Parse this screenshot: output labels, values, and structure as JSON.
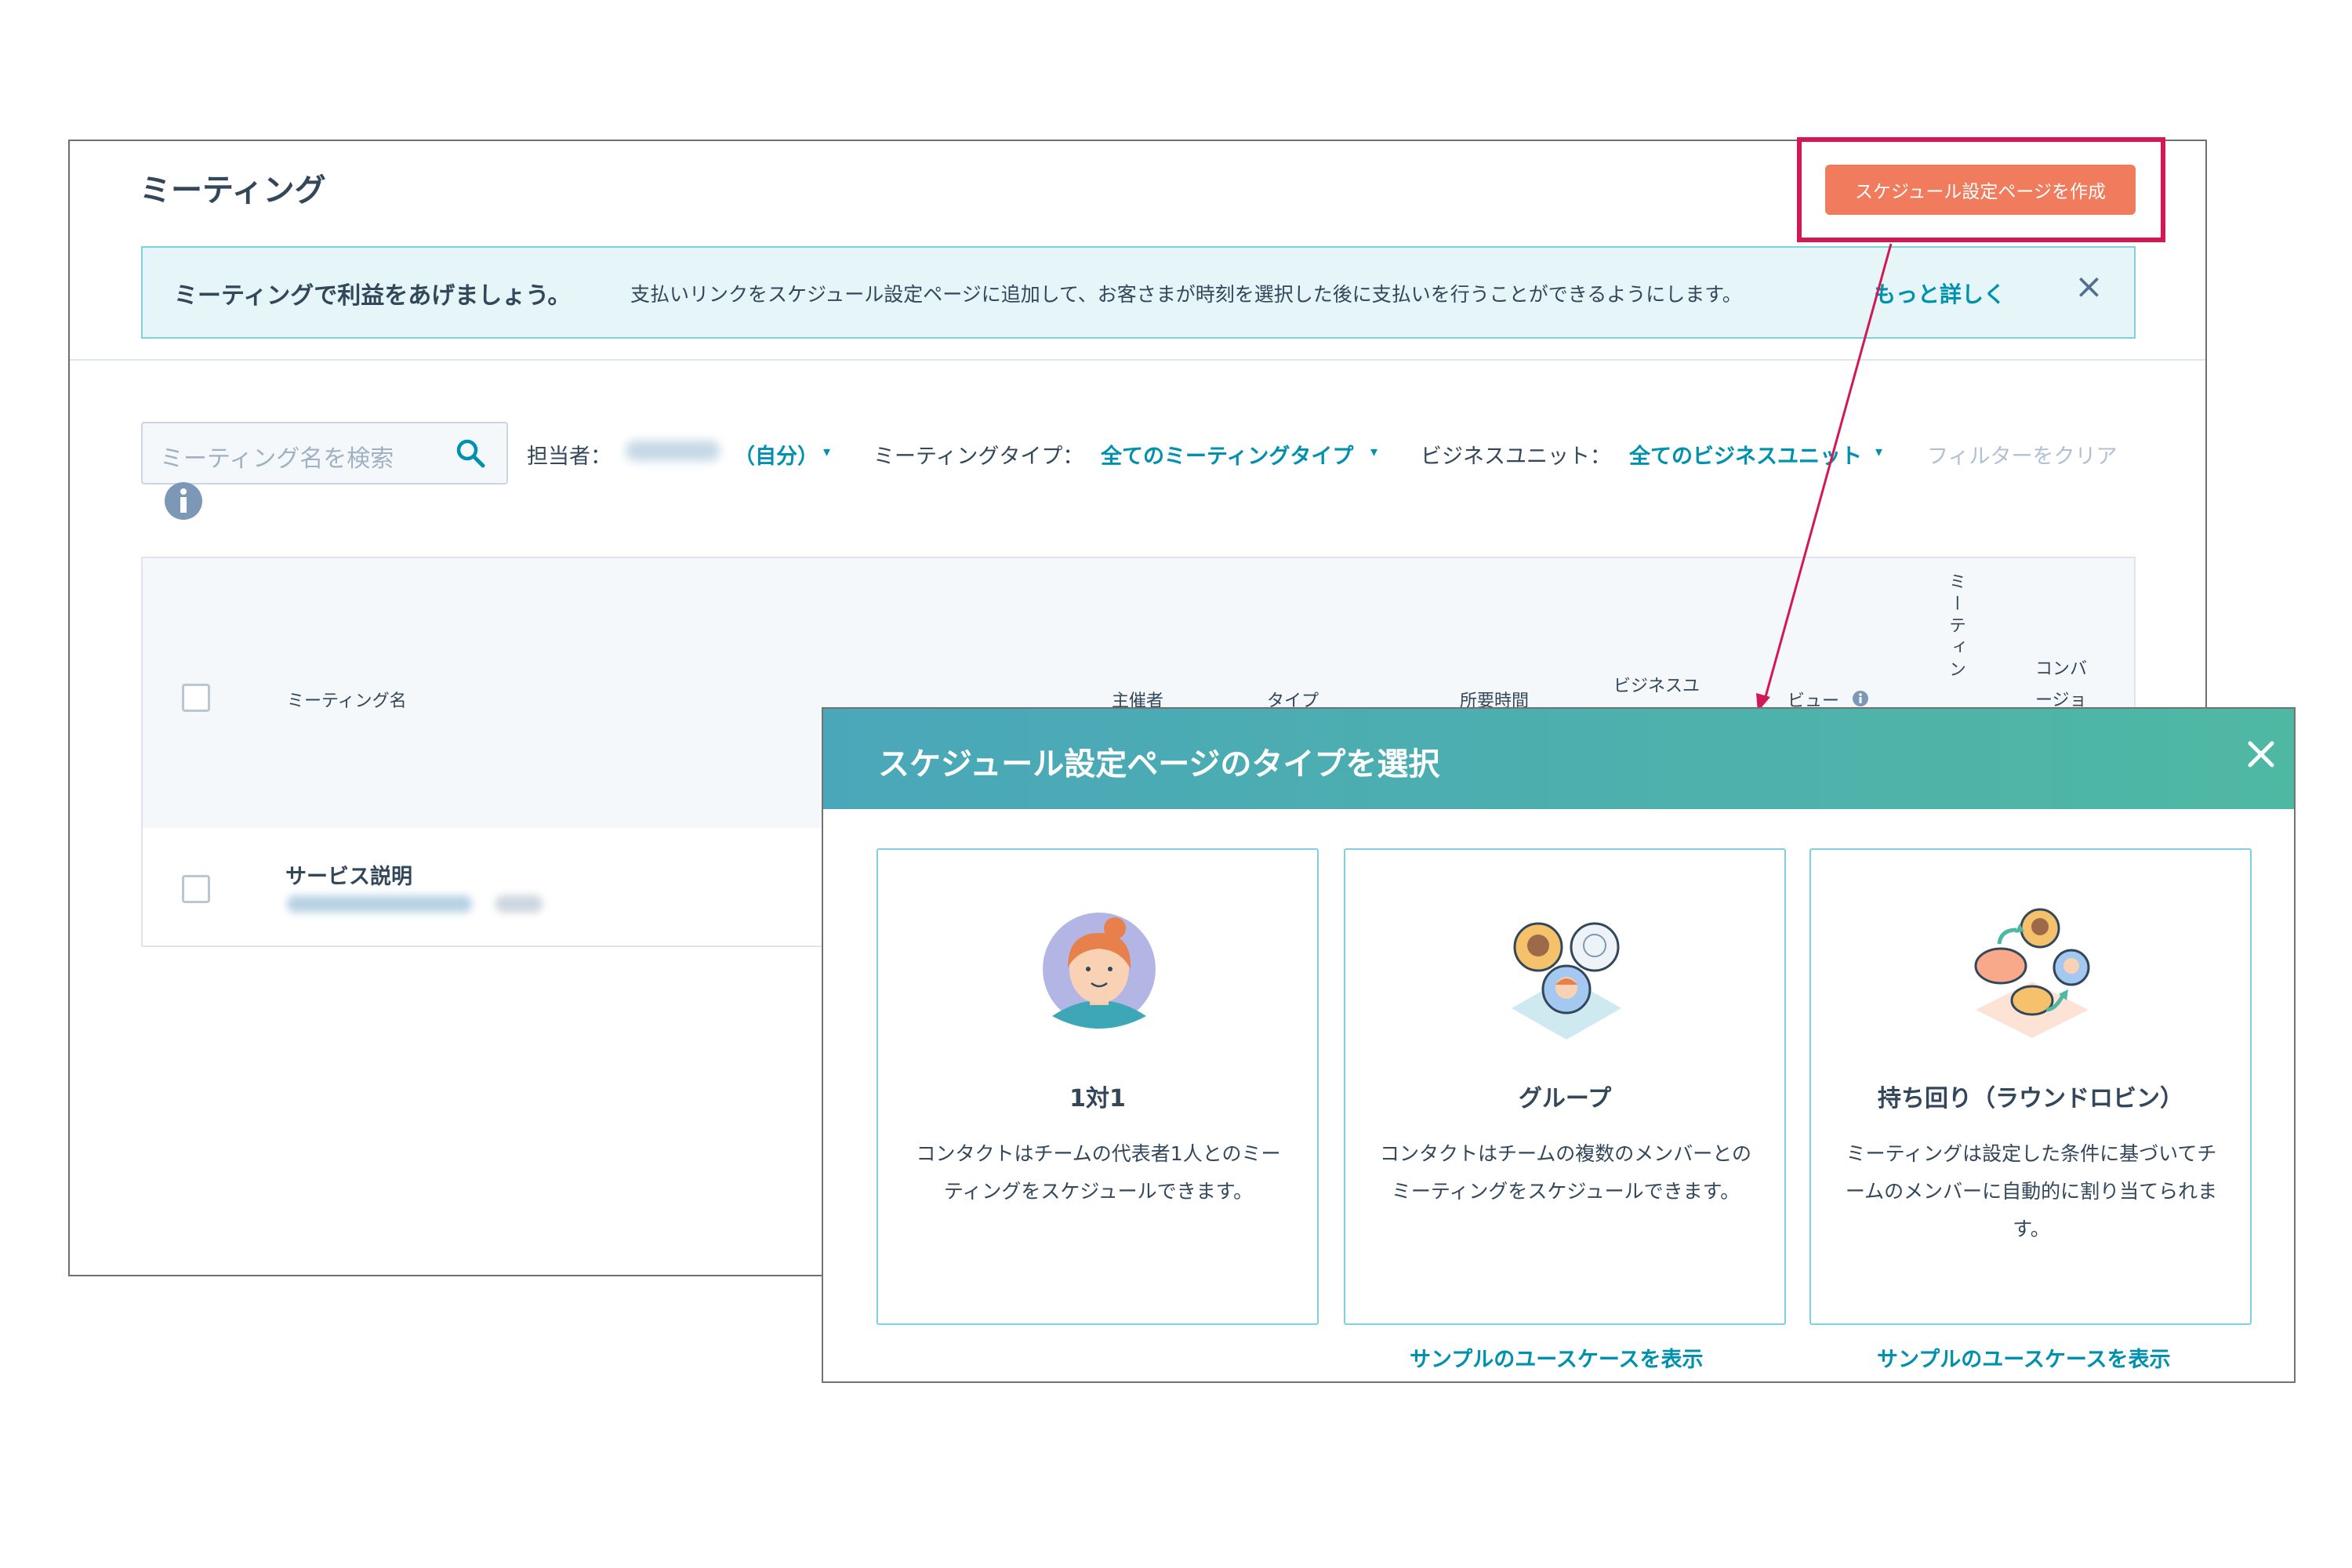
{
  "page": {
    "title": "ミーティング",
    "create_button": "スケジュール設定ページを作成"
  },
  "banner": {
    "title": "ミーティングで利益をあげましょう。",
    "text": "支払いリンクをスケジュール設定ページに追加して、お客さまが時刻を選択した後に支払いを行うことができるようにします。",
    "link": "もっと詳しく",
    "close": "×"
  },
  "filters": {
    "search_placeholder": "ミーティング名を検索",
    "owner_label": "担当者：",
    "owner_value": "（自分）",
    "type_label": "ミーティングタイプ：",
    "type_value": "全てのミーティングタイプ",
    "bu_label": "ビジネスユニット：",
    "bu_value": "全てのビジネスユニット",
    "clear": "フィルターをクリア",
    "caret": "▾"
  },
  "table": {
    "columns": {
      "name": "ミーティング名",
      "organizer": "主催者",
      "type": "タイプ",
      "duration": "所要時間",
      "business_unit": "ビジネスユニット",
      "views": "ビュー",
      "meetings": "ミーティン",
      "conversion": "コンバージョ"
    },
    "rows": [
      {
        "name": "サービス説明"
      }
    ]
  },
  "modal": {
    "title": "スケジュール設定ページのタイプを選択",
    "cards": [
      {
        "title": "1対1",
        "desc": "コンタクトはチームの代表者1人とのミーティングをスケジュールできます。"
      },
      {
        "title": "グループ",
        "desc": "コンタクトはチームの複数のメンバーとのミーティングをスケジュールできます。",
        "link": "サンプルのユースケースを表示"
      },
      {
        "title": "持ち回り（ラウンドロビン）",
        "desc": "ミーティングは設定した条件に基づいてチームのメンバーに自動的に割り当てられます。",
        "link": "サンプルのユースケースを表示"
      }
    ]
  },
  "colors": {
    "accent": "#0091ae",
    "primary_button": "#f07c5d",
    "highlight": "#d31855",
    "modal_header_start": "#4aa7b9",
    "modal_header_end": "#4fb8a3"
  }
}
